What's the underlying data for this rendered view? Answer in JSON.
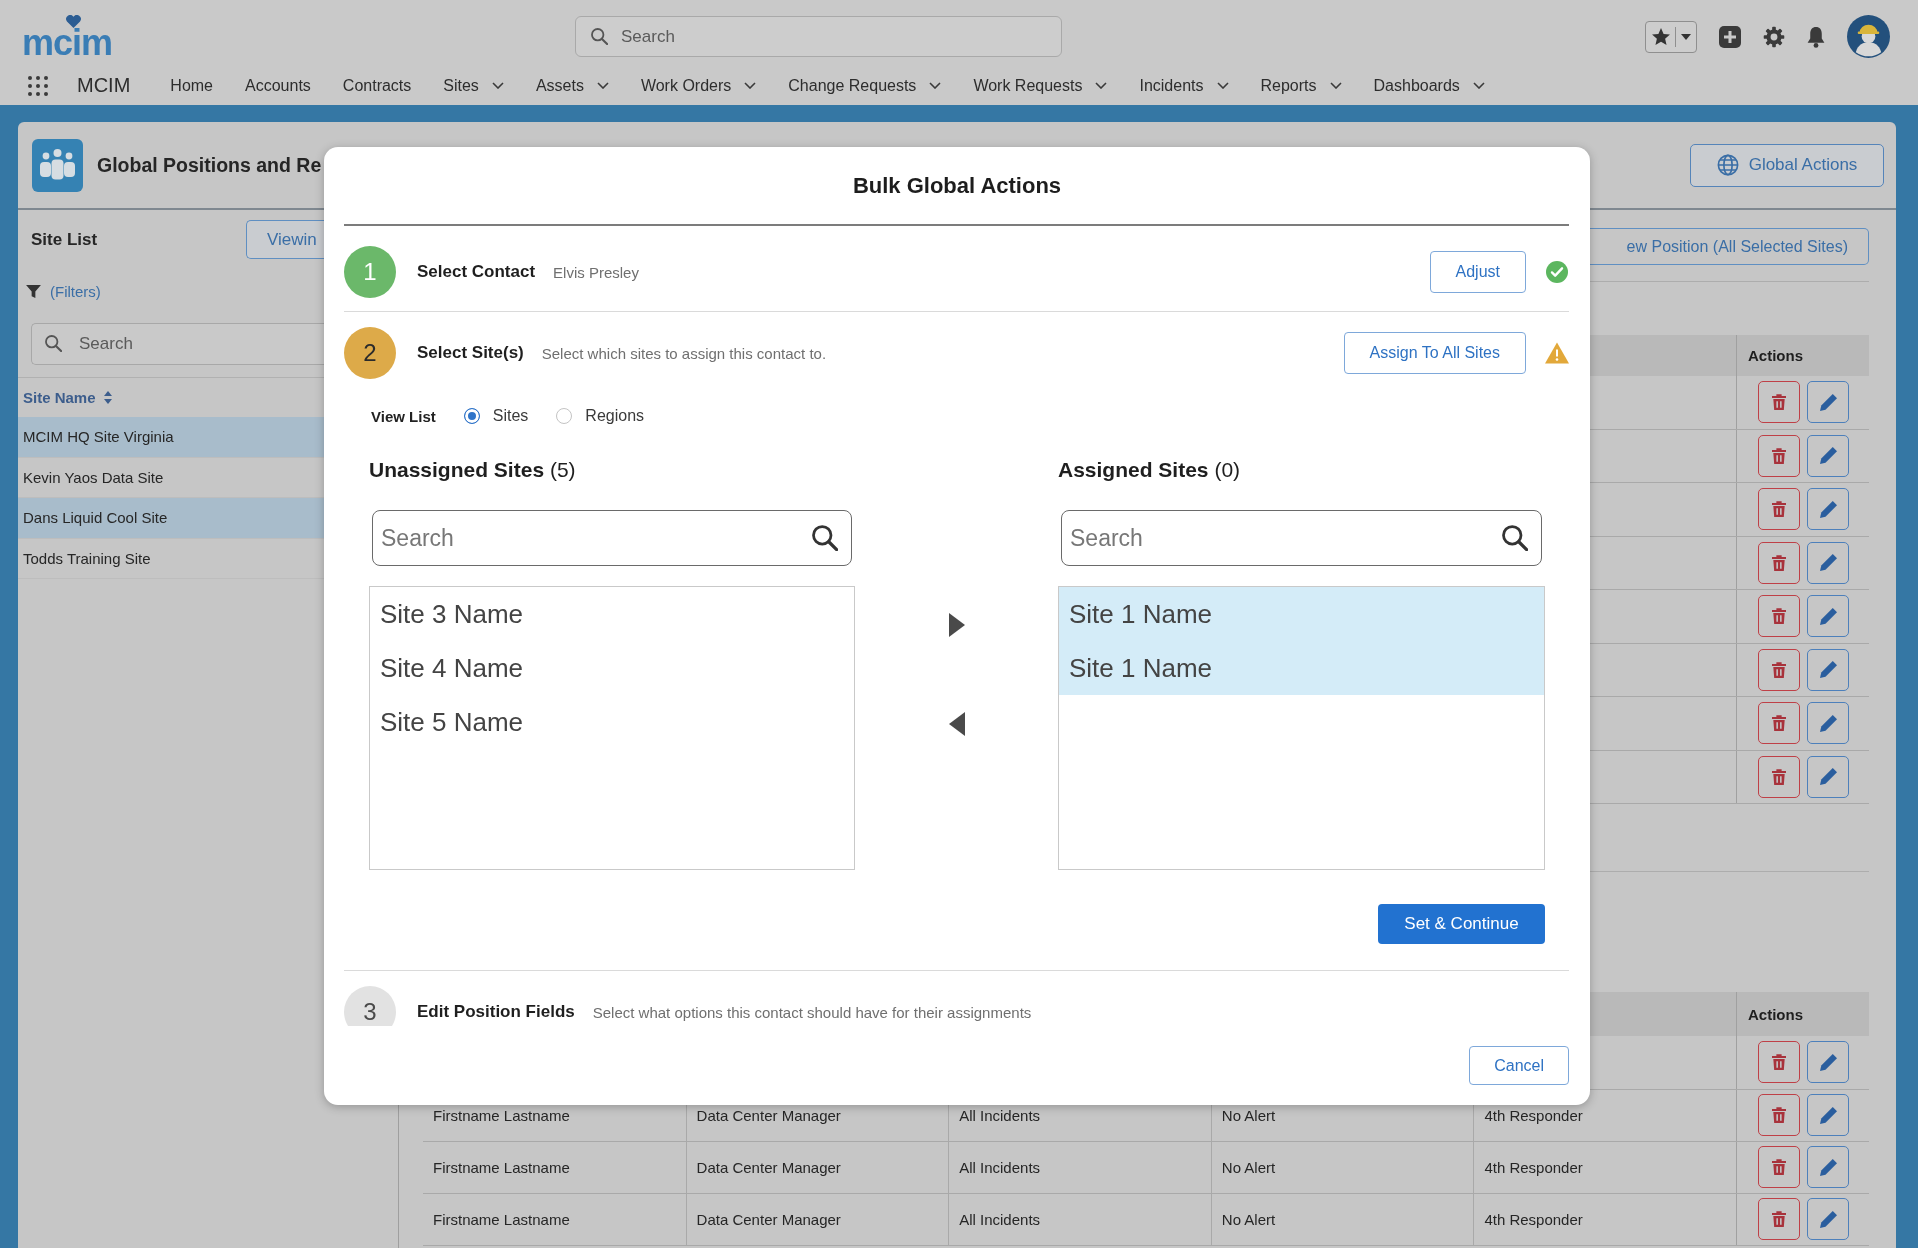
{
  "top_bar": {
    "logo": "mcim",
    "search": {
      "placeholder": "Search"
    }
  },
  "nav": {
    "app_name": "MCIM",
    "items": [
      {
        "label": "Home",
        "has_menu": false
      },
      {
        "label": "Accounts",
        "has_menu": false
      },
      {
        "label": "Contracts",
        "has_menu": false
      },
      {
        "label": "Sites",
        "has_menu": true
      },
      {
        "label": "Assets",
        "has_menu": true
      },
      {
        "label": "Work Orders",
        "has_menu": true
      },
      {
        "label": "Change Requests",
        "has_menu": true
      },
      {
        "label": "Work Requests",
        "has_menu": true
      },
      {
        "label": "Incidents",
        "has_menu": true
      },
      {
        "label": "Reports",
        "has_menu": true
      },
      {
        "label": "Dashboards",
        "has_menu": true
      }
    ]
  },
  "page_header": {
    "title": "Global Positions and Re",
    "global_actions_button": "Global Actions"
  },
  "site_list": {
    "title": "Site List",
    "viewing_button": "Viewin",
    "filters_link": "(Filters)",
    "search": {
      "placeholder": "Search"
    },
    "column": "Site Name",
    "rows": [
      {
        "name": "MCIM HQ Site Virginia",
        "selected": true
      },
      {
        "name": "Kevin Yaos Data Site",
        "selected": false
      },
      {
        "name": "Dans Liquid Cool Site",
        "selected": true
      },
      {
        "name": "Todds Training Site",
        "selected": false
      }
    ]
  },
  "positions": {
    "new_position_button": "ew Position (All Selected Sites)",
    "tables": [
      {
        "header": "Actions",
        "rows": [
          {
            "can_delete": true,
            "can_edit": true
          },
          {
            "can_delete": true,
            "can_edit": true
          },
          {
            "can_delete": true,
            "can_edit": true
          },
          {
            "can_delete": true,
            "can_edit": true
          },
          {
            "can_delete": true,
            "can_edit": true
          },
          {
            "can_delete": true,
            "can_edit": true
          },
          {
            "can_delete": true,
            "can_edit": true
          },
          {
            "can_delete": true,
            "can_edit": true
          }
        ]
      },
      {
        "header": "Actions",
        "rows": [
          {
            "can_delete": true,
            "can_edit": true
          },
          {
            "cells": [
              "Firstname Lastname",
              "Data Center Manager",
              "All Incidents",
              "No Alert",
              "4th Responder"
            ],
            "can_delete": true,
            "can_edit": true
          },
          {
            "cells": [
              "Firstname Lastname",
              "Data Center Manager",
              "All Incidents",
              "No Alert",
              "4th Responder"
            ],
            "can_delete": true,
            "can_edit": true
          },
          {
            "cells": [
              "Firstname Lastname",
              "Data Center Manager",
              "All Incidents",
              "No Alert",
              "4th Responder"
            ],
            "can_delete": true,
            "can_edit": true
          }
        ]
      }
    ]
  },
  "modal": {
    "title": "Bulk Global Actions",
    "steps": [
      {
        "number": "1",
        "title": "Select Contact",
        "detail": "Elvis Presley",
        "kind": "done",
        "button": "Adjust"
      },
      {
        "number": "2",
        "title": "Select Site(s)",
        "detail": "Select which sites to assign this contact to.",
        "kind": "warning",
        "button": "Assign To All Sites",
        "body": {
          "view_list": {
            "label": "View List",
            "options": [
              {
                "label": "Sites",
                "selected": true
              },
              {
                "label": "Regions",
                "selected": false
              }
            ]
          },
          "lists": [
            {
              "title": "**Unassigned Sites** (5)",
              "search": {
                "placeholder": "Search"
              },
              "items": [
                {
                  "name": "Site 3 Name",
                  "selected": false
                },
                {
                  "name": "Site 4 Name",
                  "selected": false
                },
                {
                  "name": "Site 5 Name",
                  "selected": false
                }
              ]
            },
            {
              "title": "**Assigned Sites** (0)",
              "search": {
                "placeholder": "Search"
              },
              "items": [
                {
                  "name": "Site 1 Name",
                  "selected": true
                },
                {
                  "name": "Site 1 Name",
                  "selected": true
                }
              ]
            }
          ],
          "continue_button": "Set & Continue"
        }
      },
      {
        "number": "3",
        "title": "Edit Position Fields",
        "detail": "Select what options this contact should have for their assignments",
        "kind": "pending"
      }
    ],
    "cancel_button": "Cancel"
  }
}
